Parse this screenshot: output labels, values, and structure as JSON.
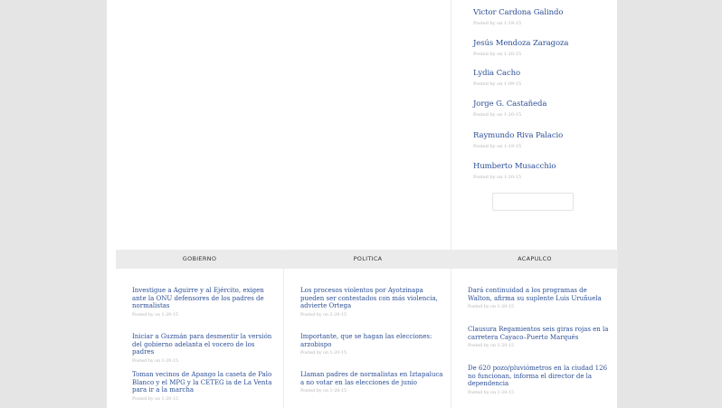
{
  "authors": [
    {
      "name": "Victor Cardona Galindo",
      "meta": "Posted by on 1-19-15"
    },
    {
      "name": "Jesús Mendoza Zaragoza",
      "meta": "Posted by on 1-20-15"
    },
    {
      "name": "Lydia Cacho",
      "meta": "Posted by on 1-09-15"
    },
    {
      "name": "Jorge G. Castañeda",
      "meta": "Posted by on 1-20-15"
    },
    {
      "name": "Raymundo Riva Palacio",
      "meta": "Posted by on 1-19-15"
    },
    {
      "name": "Humberto Musacchio",
      "meta": "Posted by on 1-20-15"
    }
  ],
  "search": {
    "placeholder": ""
  },
  "categories": [
    {
      "name": "GOBIERNO",
      "articles": [
        {
          "title": "Investigue a Aguirre y al Ejército, exigen ante la ONU defensores de los padres de normalistas",
          "meta": "Posted by on 1-20-15"
        },
        {
          "title": "Iniciar a Guzmán para desmentir la versión del gobierno adelanta el vocero de los padres",
          "meta": "Posted by on 1-20-15"
        },
        {
          "title": "Toman vecinos de Apango la caseta de Palo Blanco y el MPG y la CETEG ia de La Venta para ir a la marcha",
          "meta": "Posted by on 1-20-15"
        }
      ]
    },
    {
      "name": "POLITICA",
      "articles": [
        {
          "title": "Los procesos violentos por Ayotzinapa pueden ser contestados con más violencia, advierte Ortega",
          "meta": "Posted by on 2-20-15"
        },
        {
          "title": "Importante, que se hagan las elecciones: arzobispo",
          "meta": "Posted by on 1-20-15"
        },
        {
          "title": "Llaman padres de normalistas en Iztapaluca a no votar en las elecciones de junio",
          "meta": "Posted by on 1-20-15"
        }
      ]
    },
    {
      "name": "ACAPULCO",
      "articles": [
        {
          "title": "Dará continuidad a los programas de Walton, afirma su suplente Luis Uruñuela",
          "meta": "Posted by on 1-20-15"
        },
        {
          "title": "Clausura Regamientos seis giras rojas en la carretera Cayaco–Puerto Marqués",
          "meta": "Posted by on 1-20-15"
        },
        {
          "title": "De 620 pozo/pluviómetros en la ciudad 126 no funcionan, informa el director de la dependencia",
          "meta": "Posted by on 1-20-15"
        }
      ]
    }
  ]
}
